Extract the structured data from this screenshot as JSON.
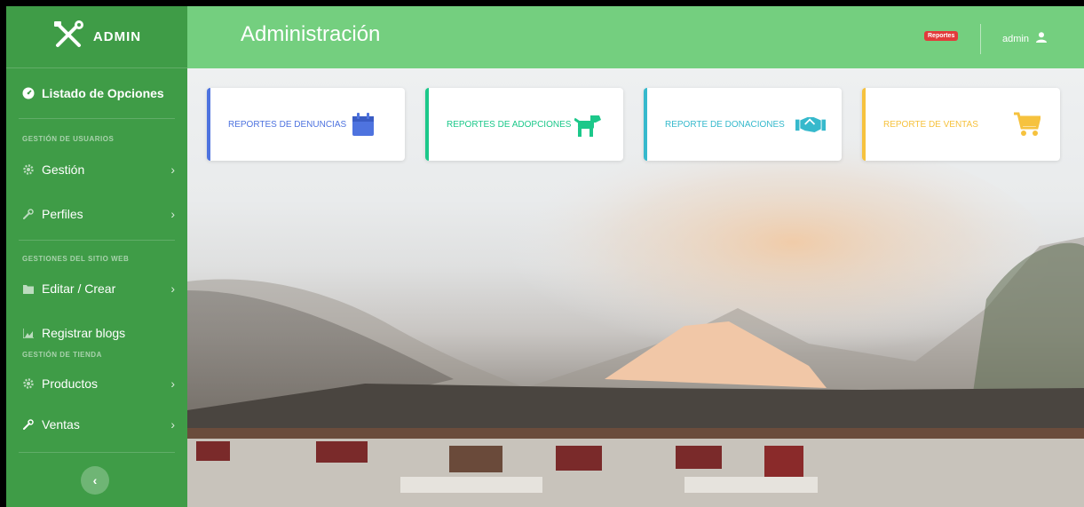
{
  "sidebar": {
    "brand": "ADMIN",
    "options_title": "Listado de Opciones",
    "heading_users": "GESTIÓN DE USUARIOS",
    "item_gestion": "Gestión",
    "item_perfiles": "Perfiles",
    "heading_site": "GESTIONES DEL SITIO WEB",
    "item_editar": "Editar / Crear",
    "item_blogs": "Registrar blogs",
    "heading_store": "GESTIÓN DE TIENDA",
    "item_productos": "Productos",
    "item_ventas": "Ventas",
    "chevron": "›",
    "toggle": "‹"
  },
  "topbar": {
    "title": "Administración",
    "reports_badge": "Reportes",
    "user": "admin"
  },
  "cards": {
    "denuncias": "REPORTES DE DENUNCIAS",
    "adopciones": "REPORTES DE ADOPCIONES",
    "donaciones": "REPORTE DE DONACIONES",
    "ventas": "REPORTE DE VENTAS"
  },
  "colors": {
    "sidebar": "#3f9c47",
    "topbar": "#74cf7f",
    "denuncias": "#4e73df",
    "adopciones": "#1cc88a",
    "donaciones": "#36b9cc",
    "ventas": "#f6c23e"
  },
  "icons": {
    "brand": "tools-icon",
    "options": "tachometer-icon",
    "gestion": "cog-icon",
    "perfiles": "wrench-icon",
    "editar": "folder-icon",
    "blogs": "chart-area-icon",
    "productos": "cog-icon",
    "ventas": "wrench-icon",
    "user": "user-icon",
    "denuncias": "calendar-icon",
    "adopciones": "dog-icon",
    "donaciones": "handshake-icon",
    "ventas_card": "shopping-cart-icon"
  }
}
